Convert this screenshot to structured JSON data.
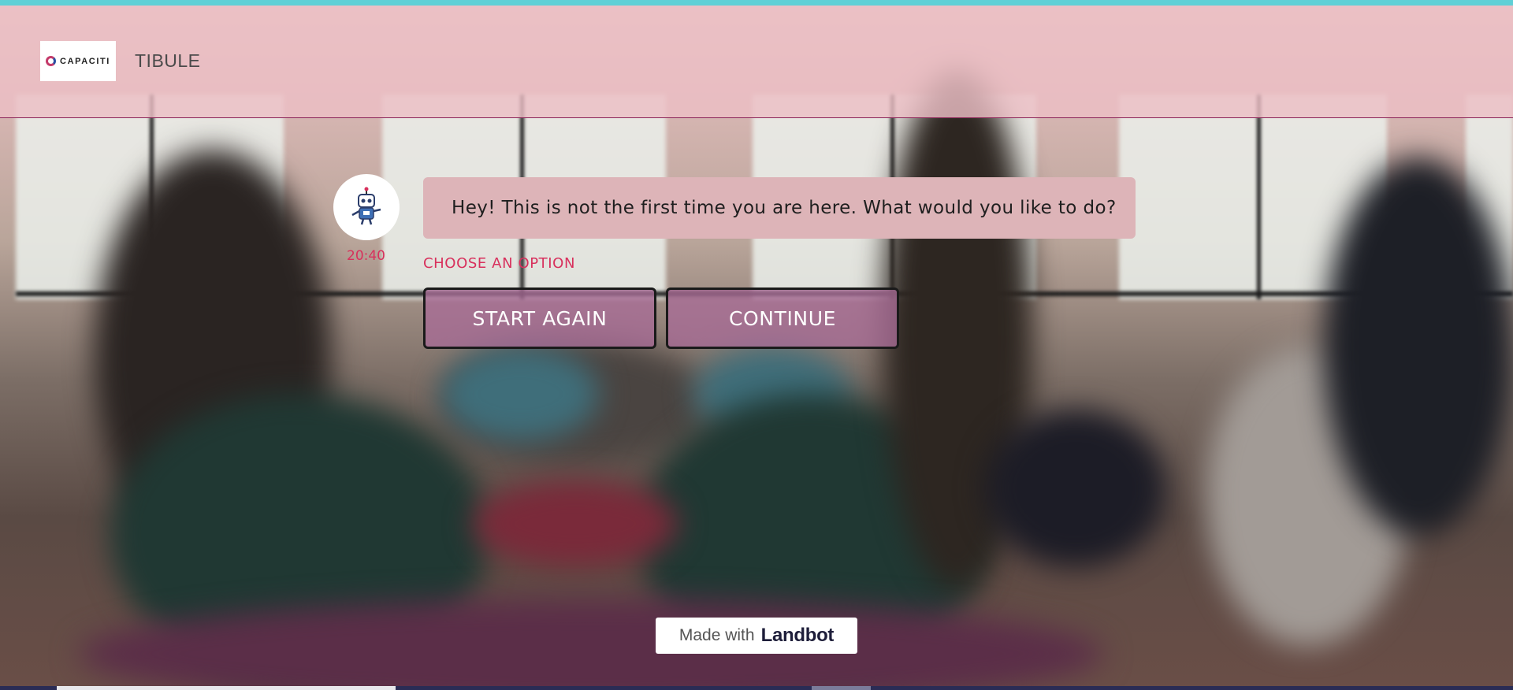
{
  "colors": {
    "top_accent": "#5fd0d6",
    "header_tint": "#ecbec4",
    "header_border": "#8b2458",
    "bubble_bg": "#ddb4b8",
    "accent_text": "#d8305c",
    "option_bg": "#a86c96",
    "option_border": "#1a1a1a"
  },
  "header": {
    "logo_text": "CAPACITI",
    "title": "TIBULE"
  },
  "chat": {
    "avatar_icon": "robot-icon",
    "timestamp": "20:40",
    "message": "Hey! This is not the first time you are here. What would you like to do?",
    "prompt": "CHOOSE AN OPTION",
    "options": [
      {
        "label": "START AGAIN"
      },
      {
        "label": "CONTINUE"
      }
    ]
  },
  "footer": {
    "made_with": "Made with",
    "brand": "Landbot"
  }
}
